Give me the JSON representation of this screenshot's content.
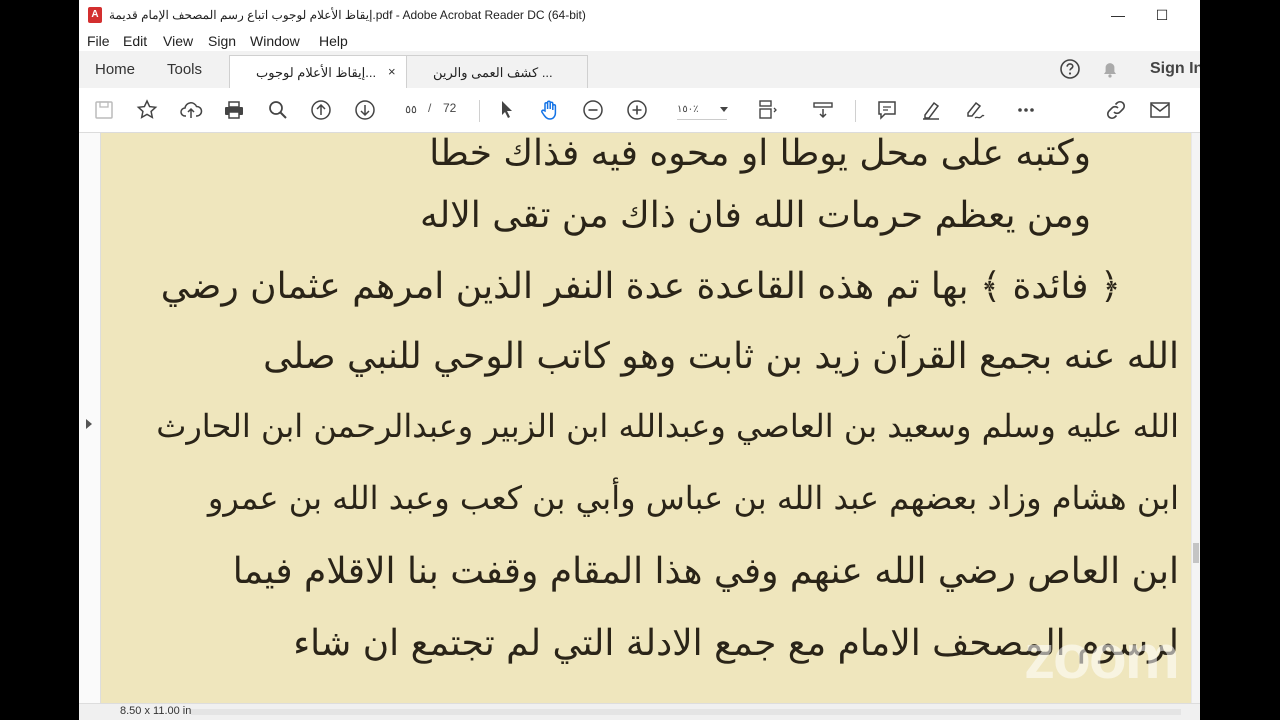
{
  "window": {
    "title": "إيقاظ الأعلام لوجوب اتباع رسم المصحف الإمام قديمة.pdf - Adobe Acrobat Reader DC (64-bit)",
    "app_icon": "acrobat-icon",
    "minimize_glyph": "—",
    "maximize_glyph": "☐"
  },
  "menu": {
    "items": [
      "File",
      "Edit",
      "View",
      "Sign",
      "Window",
      "Help"
    ]
  },
  "tabs": {
    "home": "Home",
    "tools": "Tools",
    "documents": [
      {
        "label": "إيقاظ الأعلام لوجوب...",
        "active": true,
        "close": "×"
      },
      {
        "label": "كشف العمى والرين ...",
        "active": false
      }
    ],
    "sign_in": "Sign In"
  },
  "toolbar": {
    "current_page": "٥٥",
    "page_separator": "/",
    "total_pages": "72",
    "zoom": "١٥٠٪"
  },
  "page_text": {
    "lines": [
      "وكتبه على محل يوطا    او محوه فيه فذاك خطا",
      "ومن يعظم حرمات الله    فان ذاك من تقى الاله",
      "﴿ فائدة ﴾ بها تم هذه القاعدة عدة النفر الذين امرهم عثمان رضي",
      "الله عنه بجمع القرآن زيد بن ثابت وهو كاتب الوحي للنبي صلى",
      "الله عليه وسلم وسعيد بن العاصي وعبدالله ابن الزبير وعبدالرحمن ابن الحارث",
      "ابن هشام وزاد بعضهم عبد الله بن عباس وأبي بن كعب وعبد الله بن عمرو",
      "ابن العاص رضي الله عنهم وفي هذا المقام وقفت بنا الاقلام فيما",
      "لرسوم المصحف الامام مع جمع الادلة التي لم تجتمع ان شاء"
    ]
  },
  "status": {
    "page_size": "8.50 x 11.00 in"
  },
  "overlay": {
    "watermark": "zoom"
  },
  "colors": {
    "page_bg": "#efe6bd",
    "ink": "#2a2418",
    "acrobat_red": "#d32f2f"
  }
}
